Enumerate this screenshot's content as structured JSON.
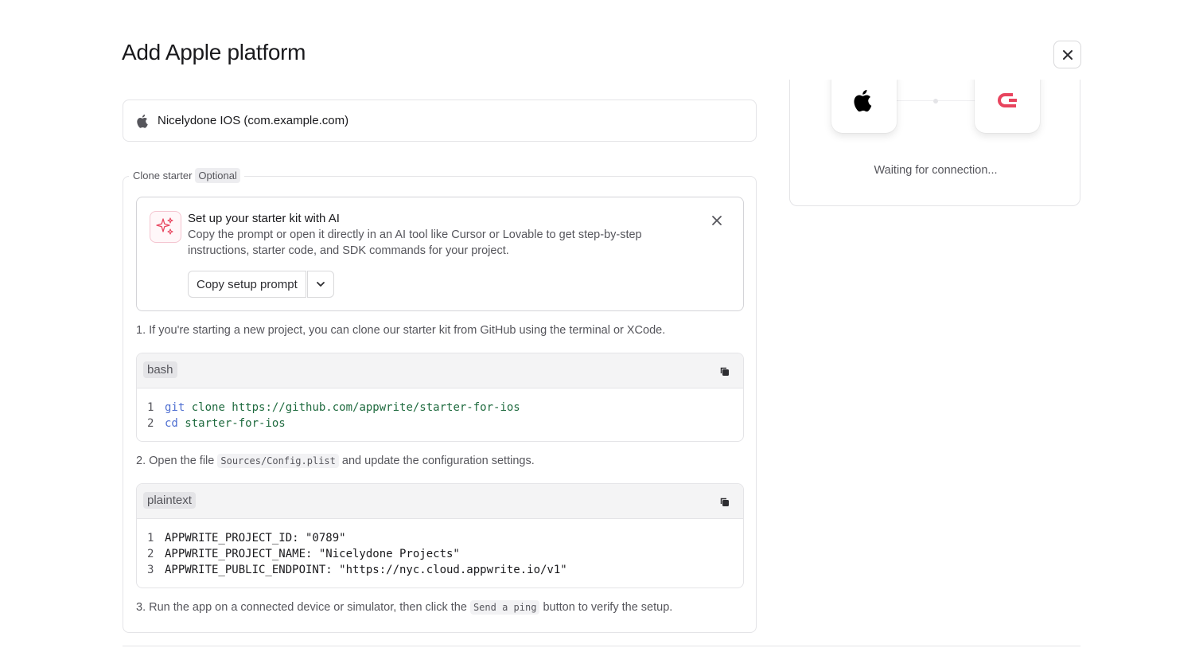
{
  "modal": {
    "title": "Add Apple platform",
    "close_icon": "close-icon"
  },
  "app_field": {
    "icon": "apple-icon",
    "value": "Nicelydone IOS (com.example.com)"
  },
  "clone_starter": {
    "legend": "Clone starter",
    "badge": "Optional"
  },
  "ai_card": {
    "icon": "sparkles-icon",
    "title": "Set up your starter kit with AI",
    "description": "Copy the prompt or open it directly in an AI tool like Cursor or Lovable to get step-by-step instructions, starter code, and SDK commands for your project.",
    "copy_button": "Copy setup prompt",
    "dropdown_icon": "chevron-down-icon",
    "close_icon": "close-icon"
  },
  "steps": {
    "step1": "1. If you're starting a new project, you can clone our starter kit from GitHub using the terminal or XCode.",
    "step2_prefix": "2. Open the file",
    "step2_code": "Sources/Config.plist",
    "step2_suffix": "and update the configuration settings.",
    "step3_prefix": "3. Run the app on a connected device or simulator, then click the",
    "step3_code": "Send a ping",
    "step3_suffix": "button to verify the setup."
  },
  "code_bash": {
    "lang": "bash",
    "copy_icon": "copy-icon",
    "lines": [
      {
        "num": "1",
        "cmd": "git",
        "rest": " clone https://github.com/appwrite/starter-for-ios"
      },
      {
        "num": "2",
        "cmd": "cd",
        "rest": " starter-for-ios"
      }
    ]
  },
  "code_plain": {
    "lang": "plaintext",
    "copy_icon": "copy-icon",
    "lines": [
      {
        "num": "1",
        "text": "APPWRITE_PROJECT_ID: \"0789\""
      },
      {
        "num": "2",
        "text": "APPWRITE_PROJECT_NAME: \"Nicelydone Projects\""
      },
      {
        "num": "3",
        "text": "APPWRITE_PUBLIC_ENDPOINT: \"https://nyc.cloud.appwrite.io/v1\""
      }
    ]
  },
  "connection": {
    "left_icon": "apple-icon",
    "right_icon": "appwrite-logo-icon",
    "status": "Waiting for connection..."
  },
  "colors": {
    "accent_pink": "#e8445e",
    "border": "#e4e4e7",
    "muted_text": "#56565c",
    "code_keyword": "#4f6fd1",
    "code_string": "#1f6b3f"
  }
}
